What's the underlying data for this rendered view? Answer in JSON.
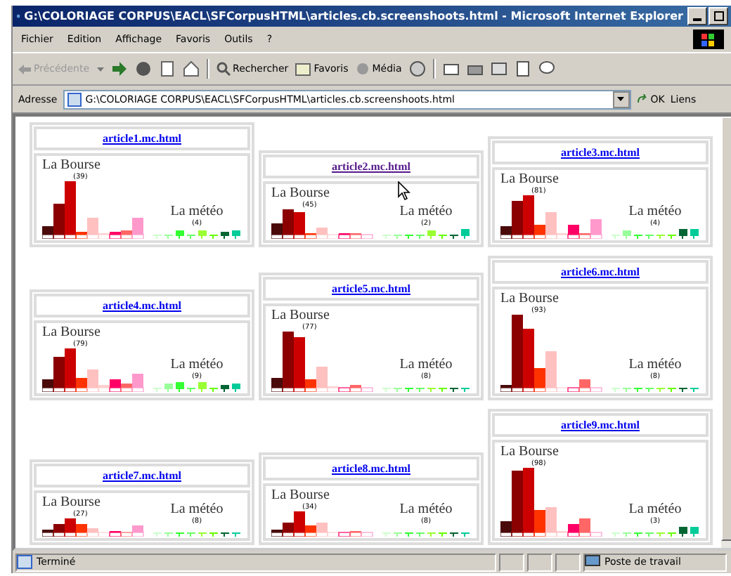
{
  "window": {
    "title": "G:\\COLORIAGE CORPUS\\EACL\\SFCorpusHTML\\articles.cb.screenshoots.html - Microsoft Internet Explorer"
  },
  "menu": [
    "Fichier",
    "Edition",
    "Affichage",
    "Favoris",
    "Outils",
    "?"
  ],
  "toolbar": {
    "back": {
      "label": "Précédente",
      "disabled": true
    },
    "search": "Rechercher",
    "favorites": "Favoris",
    "media": "Média"
  },
  "address": {
    "label": "Adresse",
    "value": "G:\\COLORIAGE CORPUS\\EACL\\SFCorpusHTML\\articles.cb.screenshoots.html",
    "go": "OK",
    "links": "Liens"
  },
  "articles": [
    {
      "link": "article1.mc.html",
      "visited": false,
      "bourse_label": "La Bourse",
      "bourse_count": "(39)",
      "meteo_label": "La météo",
      "meteo_count": "(4)"
    },
    {
      "link": "article2.mc.html",
      "visited": true,
      "bourse_label": "La Bourse",
      "bourse_count": "(45)",
      "meteo_label": "La météo",
      "meteo_count": "(2)"
    },
    {
      "link": "article3.mc.html",
      "visited": false,
      "bourse_label": "La Bourse",
      "bourse_count": "(81)",
      "meteo_label": "La météo",
      "meteo_count": "(4)"
    },
    {
      "link": "article4.mc.html",
      "visited": false,
      "bourse_label": "La Bourse",
      "bourse_count": "(79)",
      "meteo_label": "La météo",
      "meteo_count": "(9)"
    },
    {
      "link": "article5.mc.html",
      "visited": false,
      "bourse_label": "La Bourse",
      "bourse_count": "(77)",
      "meteo_label": "La météo",
      "meteo_count": "(8)"
    },
    {
      "link": "article6.mc.html",
      "visited": false,
      "bourse_label": "La Bourse",
      "bourse_count": "(93)",
      "meteo_label": "La météo",
      "meteo_count": "(8)"
    },
    {
      "link": "article7.mc.html",
      "visited": false,
      "bourse_label": "La Bourse",
      "bourse_count": "(27)",
      "meteo_label": "La météo",
      "meteo_count": "(8)"
    },
    {
      "link": "article8.mc.html",
      "visited": false,
      "bourse_label": "La Bourse",
      "bourse_count": "(34)",
      "meteo_label": "La météo",
      "meteo_count": "(8)"
    },
    {
      "link": "article9.mc.html",
      "visited": false,
      "bourse_label": "La Bourse",
      "bourse_count": "(98)",
      "meteo_label": "La météo",
      "meteo_count": "(3)"
    }
  ],
  "status_bar": {
    "text": "Terminé",
    "zone": "Poste de travail"
  }
}
